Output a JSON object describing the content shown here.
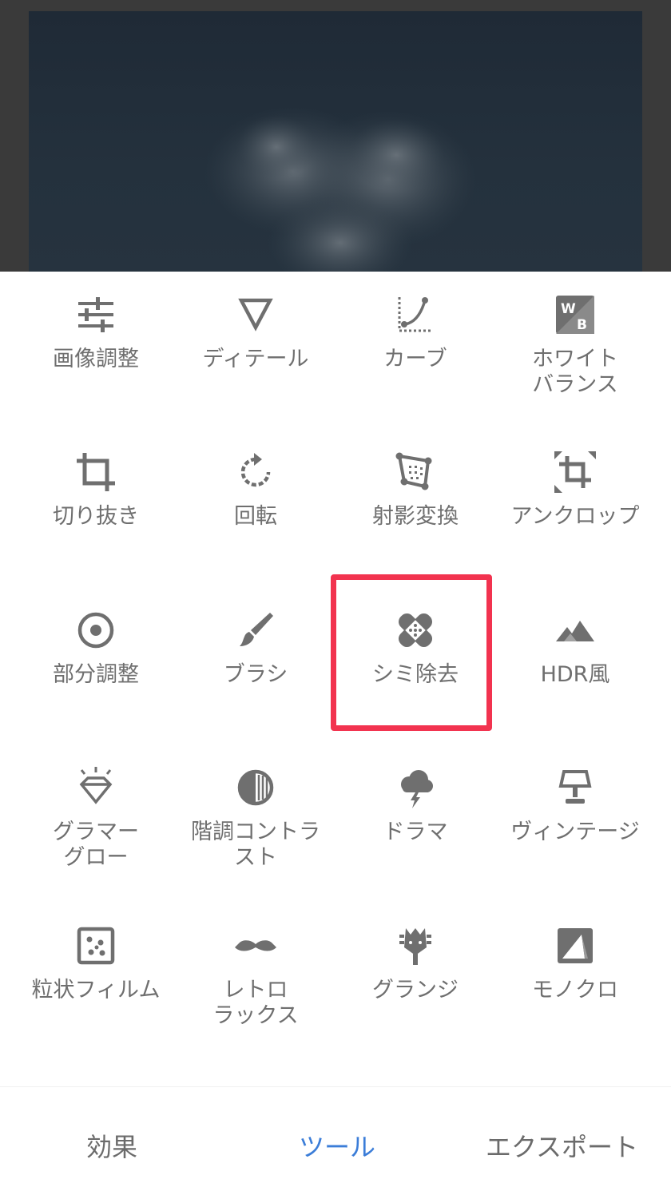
{
  "tools": [
    {
      "id": "tune",
      "label": "画像調整",
      "icon": "sliders-icon"
    },
    {
      "id": "details",
      "label": "ディテール",
      "icon": "triangle-icon"
    },
    {
      "id": "curves",
      "label": "カーブ",
      "icon": "curve-icon"
    },
    {
      "id": "white-balance",
      "label": "ホワイト\nバランス",
      "icon": "wb-icon"
    },
    {
      "id": "crop",
      "label": "切り抜き",
      "icon": "crop-icon"
    },
    {
      "id": "rotate",
      "label": "回転",
      "icon": "rotate-icon"
    },
    {
      "id": "perspective",
      "label": "射影変換",
      "icon": "perspective-icon"
    },
    {
      "id": "expand",
      "label": "アンクロップ",
      "icon": "expand-icon"
    },
    {
      "id": "selective",
      "label": "部分調整",
      "icon": "target-icon"
    },
    {
      "id": "brush",
      "label": "ブラシ",
      "icon": "brush-icon"
    },
    {
      "id": "healing",
      "label": "シミ除去",
      "icon": "bandage-icon"
    },
    {
      "id": "hdr",
      "label": "HDR風",
      "icon": "mountains-icon"
    },
    {
      "id": "glamour-glow",
      "label": "グラマー\nグロー",
      "icon": "diamond-icon"
    },
    {
      "id": "tonal-contrast",
      "label": "階調コントラ\nスト",
      "icon": "contrast-icon"
    },
    {
      "id": "drama",
      "label": "ドラマ",
      "icon": "storm-cloud-icon"
    },
    {
      "id": "vintage",
      "label": "ヴィンテージ",
      "icon": "lamp-icon"
    },
    {
      "id": "grainy-film",
      "label": "粒状フィルム",
      "icon": "grain-icon"
    },
    {
      "id": "retrolux",
      "label": "レトロ\nラックス",
      "icon": "mustache-icon"
    },
    {
      "id": "grunge",
      "label": "グランジ",
      "icon": "guitar-icon"
    },
    {
      "id": "bw",
      "label": "モノクロ",
      "icon": "bw-icon"
    }
  ],
  "tabs": {
    "looks": "効果",
    "tools": "ツール",
    "export": "エクスポート"
  },
  "colors": {
    "active_tab": "#3b7dd8",
    "highlight": "#f2334f",
    "icon": "#6f6f6f"
  }
}
